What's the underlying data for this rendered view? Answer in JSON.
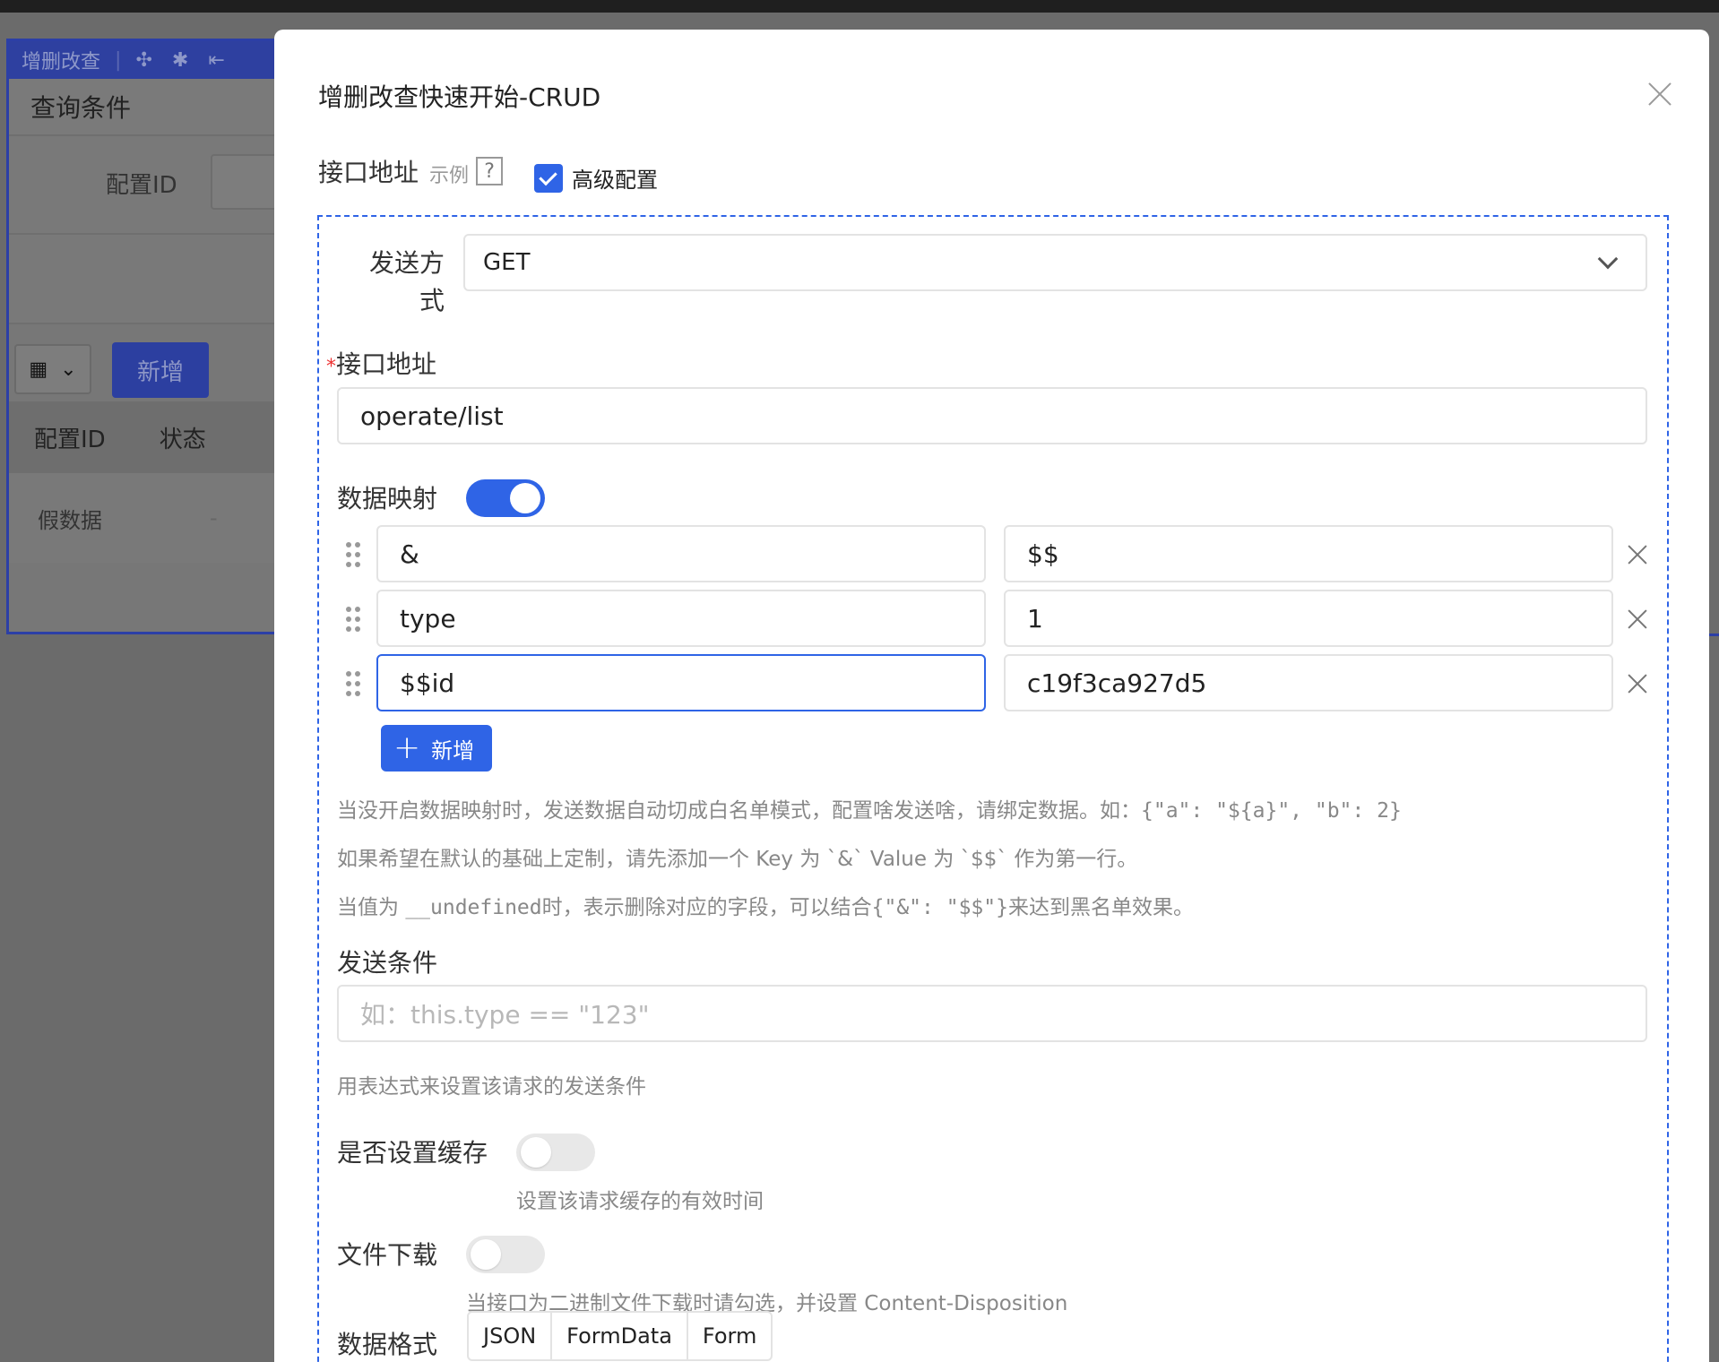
{
  "background": {
    "header_title": "增删改查",
    "query_title": "查询条件",
    "field_label": "配置ID",
    "add_button": "新增",
    "table_headers": [
      "配置ID",
      "状态"
    ],
    "row_first_cell": "假数据",
    "row_second_cell": "-"
  },
  "modal": {
    "title": "增删改查快速开始-CRUD",
    "api_label": "接口地址",
    "example_text": "示例",
    "help_icon": "?",
    "advanced_label": "高级配置",
    "advanced_checked": true,
    "method_label": "发送方式",
    "method_value": "GET",
    "url_label": "接口地址",
    "required_mark": "*",
    "url_value": "operate/list",
    "mapping_label": "数据映射",
    "mapping_enabled": true,
    "mapping_rows": [
      {
        "key": "&",
        "value": "$$"
      },
      {
        "key": "type",
        "value": "1"
      },
      {
        "key": "$$id",
        "value": "c19f3ca927d5"
      }
    ],
    "add_label": "新增",
    "hint_1": "当没开启数据映射时，发送数据自动切成白名单模式，配置啥发送啥，请绑定数据。如：",
    "hint_1_code": "{\"a\": \"${a}\", \"b\": 2}",
    "hint_2": "如果希望在默认的基础上定制，请先添加一个 Key 为 `&` Value 为 `$$` 作为第一行。",
    "hint_3_a": "当值为 ",
    "hint_3_code_a": "__undefined",
    "hint_3_b": "时，表示删除对应的字段，可以结合",
    "hint_3_code_b": "{\"&\": \"$$\"}",
    "hint_3_c": "来达到黑名单效果。",
    "condition_label": "发送条件",
    "condition_placeholder": "如：this.type == \"123\"",
    "condition_hint": "用表达式来设置该请求的发送条件",
    "cache_label": "是否设置缓存",
    "cache_enabled": false,
    "cache_hint": "设置该请求缓存的有效时间",
    "download_label": "文件下载",
    "download_enabled": false,
    "download_hint": "当接口为二进制文件下载时请勾选，并设置 Content-Disposition",
    "format_label": "数据格式",
    "format_options": [
      "JSON",
      "FormData",
      "Form"
    ]
  },
  "colors": {
    "primary": "#2f64e6",
    "required": "#e33333"
  }
}
